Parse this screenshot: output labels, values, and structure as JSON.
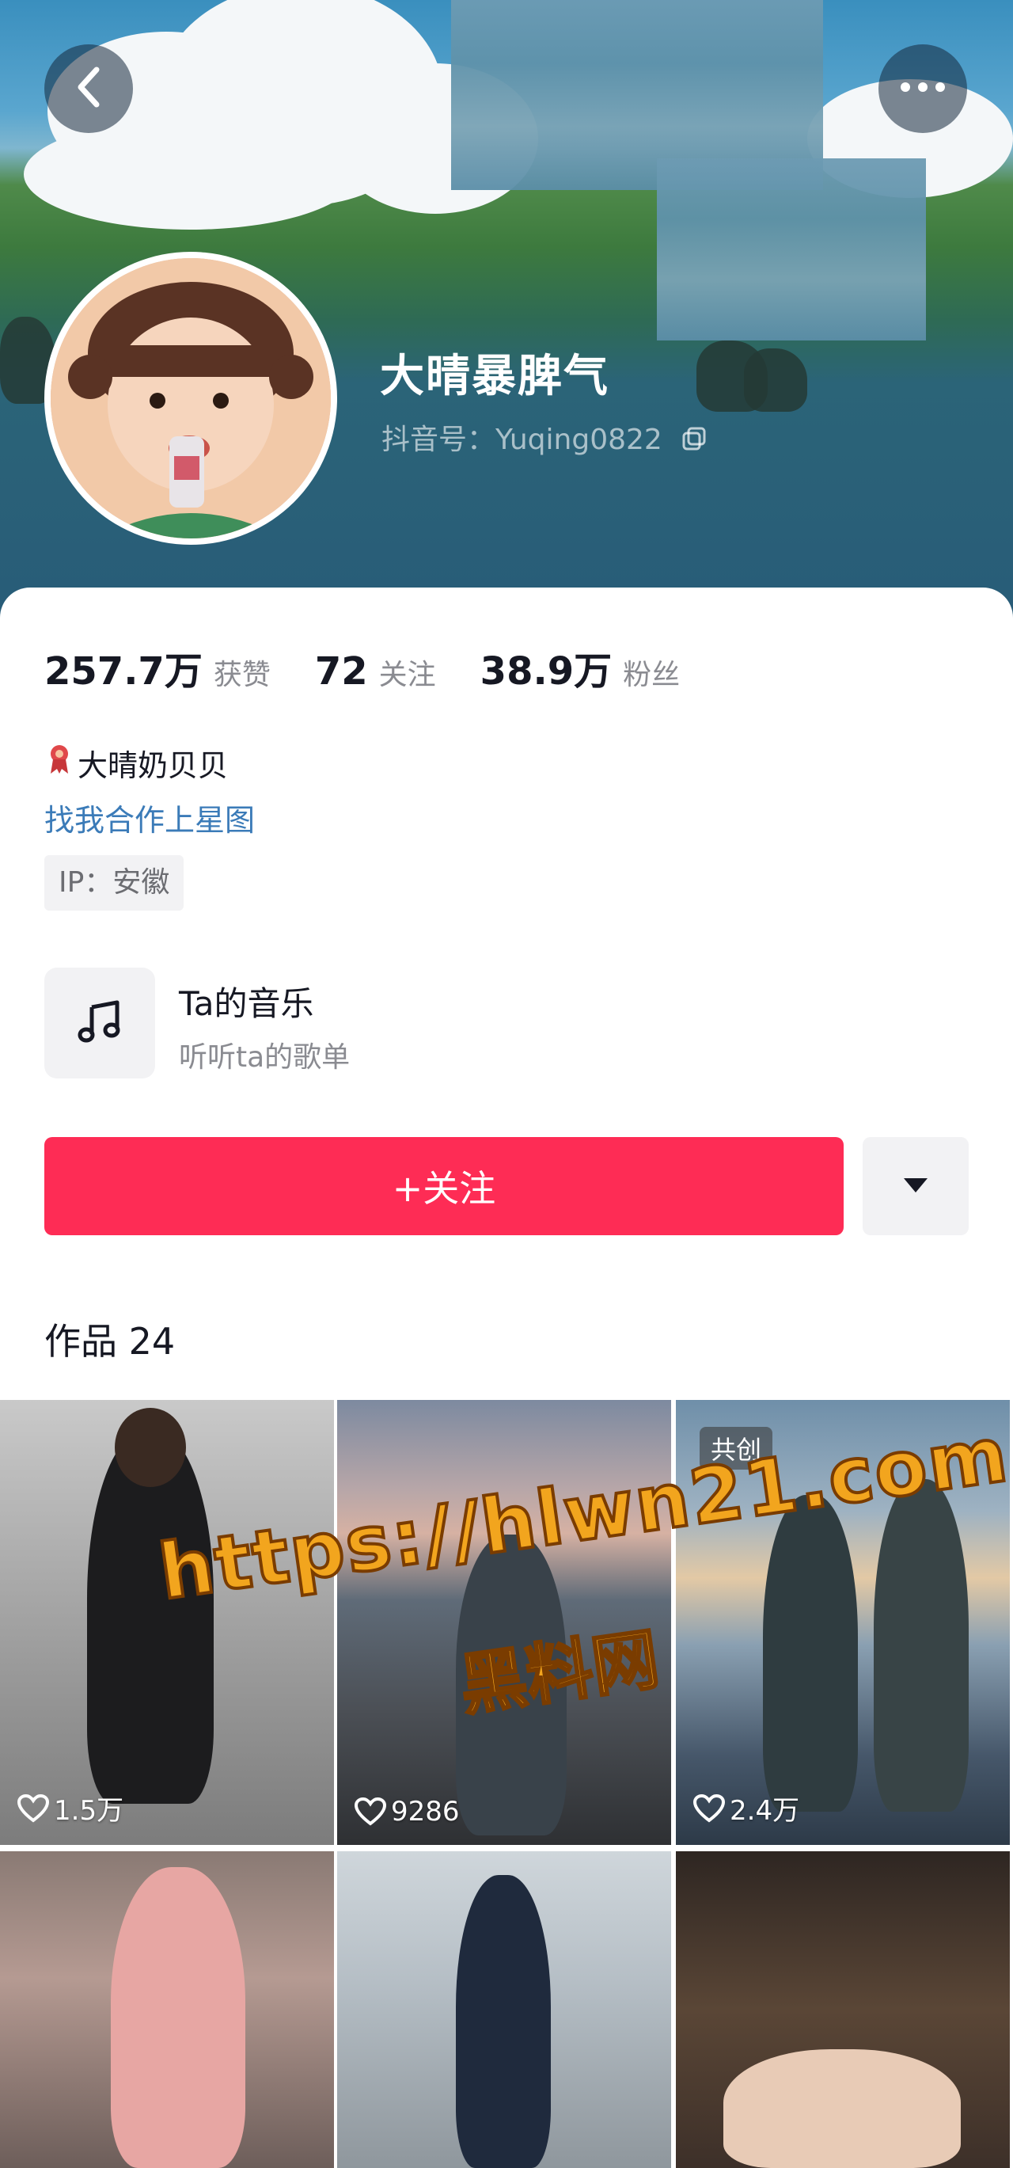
{
  "profile": {
    "nickname": "大晴暴脾气",
    "douyin_id": "抖音号：Yuqing0822"
  },
  "stats": [
    {
      "value": "257.7万",
      "label": "获赞"
    },
    {
      "value": "72",
      "label": "关注"
    },
    {
      "value": "38.9万",
      "label": "粉丝"
    }
  ],
  "bio": {
    "honor": "大晴奶贝贝",
    "star_link": "找我合作上星图",
    "ip": "IP：安徽"
  },
  "music": {
    "title": "Ta的音乐",
    "subtitle": "听听ta的歌单",
    "icon": "music-note-icon"
  },
  "actions": {
    "follow_label": "+关注",
    "dropdown_icon": "triangle-down-icon"
  },
  "works": {
    "title": "作品 24",
    "items": [
      {
        "likes": "1.5万"
      },
      {
        "likes": "9286"
      },
      {
        "likes": "2.4万",
        "badge": "共创"
      },
      {},
      {},
      {}
    ]
  },
  "watermark": {
    "url": "https://hlwn21.com",
    "name": "黑料网"
  },
  "colors": {
    "accent": "#fe2c55",
    "link": "#3b7bb8",
    "text": "#161823",
    "secondary": "#8a8b91"
  }
}
